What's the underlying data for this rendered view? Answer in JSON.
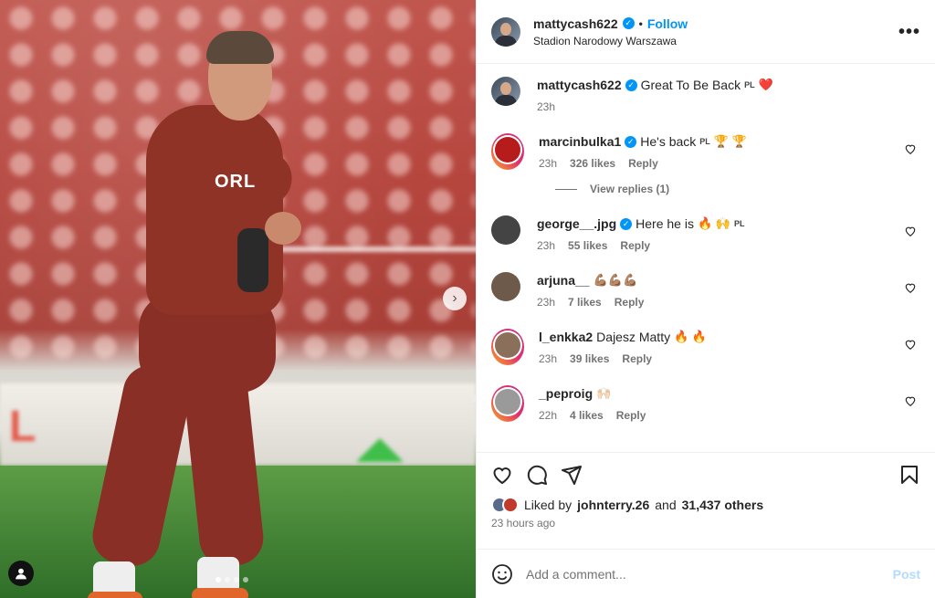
{
  "post": {
    "author": "mattycash622",
    "location": "Stadion Narodowy Warszawa",
    "follow_label": "Follow",
    "bullet": "•",
    "more_label": "•••",
    "caption_text": "Great To Be Back",
    "caption_flag": "PL",
    "caption_emoji": "❤️",
    "caption_time": "23h",
    "photo_sign_text": "ORL",
    "carousel_dots": 4,
    "carousel_active": 0
  },
  "comments": [
    {
      "user": "marcinbulka1",
      "verified": true,
      "text": "He's back",
      "flag": "PL",
      "emoji": "🏆 🏆",
      "time": "23h",
      "likes": "326 likes",
      "reply": "Reply",
      "avatar_color": "#b71c1c"
    },
    {
      "user": "george__.jpg",
      "verified": true,
      "text": "Here he is",
      "emoji": "🔥 🙌",
      "flag": "PL",
      "time": "23h",
      "likes": "55 likes",
      "reply": "Reply",
      "avatar_color": "#444444"
    },
    {
      "user": "arjuna__",
      "verified": false,
      "text": "",
      "emoji": "💪🏽💪🏽💪🏽",
      "time": "23h",
      "likes": "7 likes",
      "reply": "Reply",
      "avatar_color": "#6d5a4a"
    },
    {
      "user": "l_enkka2",
      "verified": false,
      "text": "Dajesz Matty",
      "emoji": "🔥 🔥",
      "time": "23h",
      "likes": "39 likes",
      "reply": "Reply",
      "avatar_color": "#8a6f5a"
    },
    {
      "user": "_peproig",
      "verified": false,
      "text": "",
      "emoji": "🙌🏻",
      "time": "22h",
      "likes": "4 likes",
      "reply": "Reply",
      "avatar_color": "#9a9a9a"
    }
  ],
  "view_replies": "View replies (1)",
  "likes": {
    "prefix": "Liked by",
    "user": "johnterry.26",
    "middle": "and",
    "others": "31,437 others",
    "time_ago": "23 hours ago"
  },
  "add_comment": {
    "placeholder": "Add a comment...",
    "post_label": "Post"
  },
  "colors": {
    "accent": "#0095f6",
    "heart": "#ed4956",
    "post_disabled": "#b3dbff"
  }
}
